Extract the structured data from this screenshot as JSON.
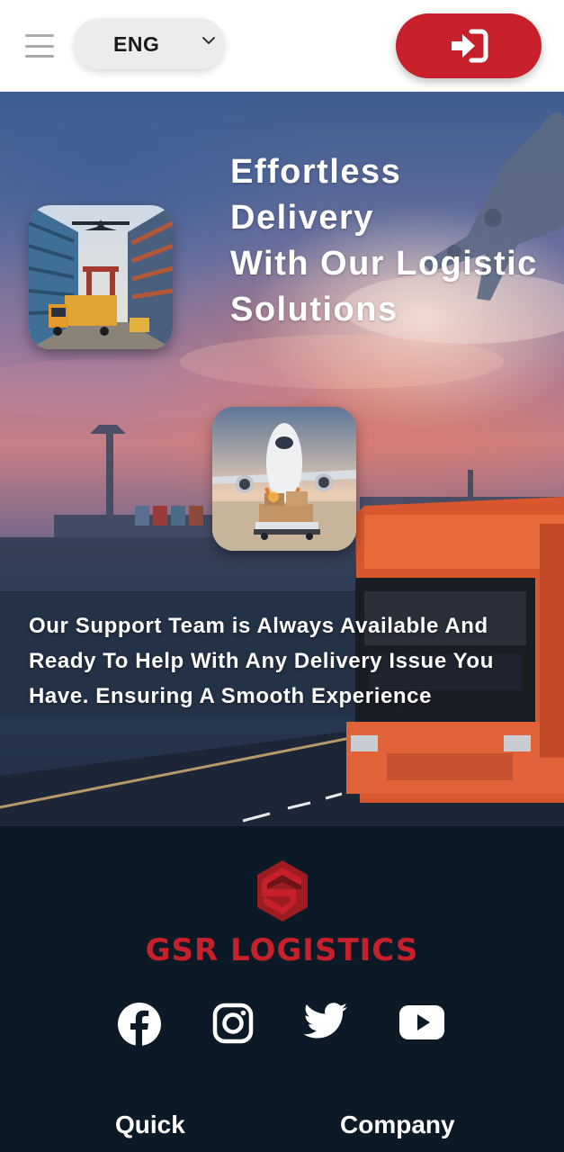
{
  "header": {
    "menu_icon": "hamburger-menu-icon",
    "language": {
      "selected": "ENG",
      "icon": "chevron-down-icon"
    },
    "login_icon": "sign-in-icon",
    "accent_color": "#c8202a"
  },
  "hero": {
    "title_lines": [
      "Effortless",
      "Delivery",
      "With Our Logistic",
      "Solutions"
    ],
    "description": "Our Support Team is Always Available And Ready To Help With Any Delivery Issue You Have. Ensuring A Smooth Experience",
    "images": [
      "warehouse-truck-airplane-image",
      "cargo-airplane-loading-image"
    ]
  },
  "footer": {
    "brand": "GSR LOGISTICS",
    "brand_color": "#c8202a",
    "social_icons": [
      "facebook-icon",
      "instagram-icon",
      "twitter-icon",
      "youtube-icon"
    ],
    "headings": {
      "quick": "Quick",
      "company": "Company"
    }
  }
}
